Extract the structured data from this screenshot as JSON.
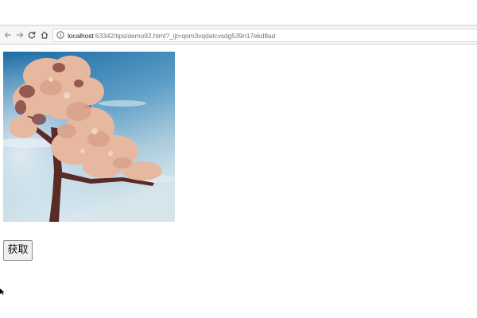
{
  "browser": {
    "url_host": "localhost",
    "url_rest": ":63342/tips/demo92.html?_ijt=qom3vqdatcvsdg539n17ekd8ad",
    "nav_icons": [
      "back-arrow-icon",
      "forward-arrow-icon",
      "reload-icon",
      "home-icon",
      "info-icon"
    ]
  },
  "page": {
    "image_subject": "flowering-tree-photo",
    "button_label": "获取"
  },
  "colors": {
    "sky_top": "#1f6fa6",
    "sky_bottom": "#cfe1ea",
    "blossom": "#e8b9a0",
    "trunk": "#5a2a26",
    "button_bg": "#efefef",
    "button_border": "#8d8d8d"
  }
}
